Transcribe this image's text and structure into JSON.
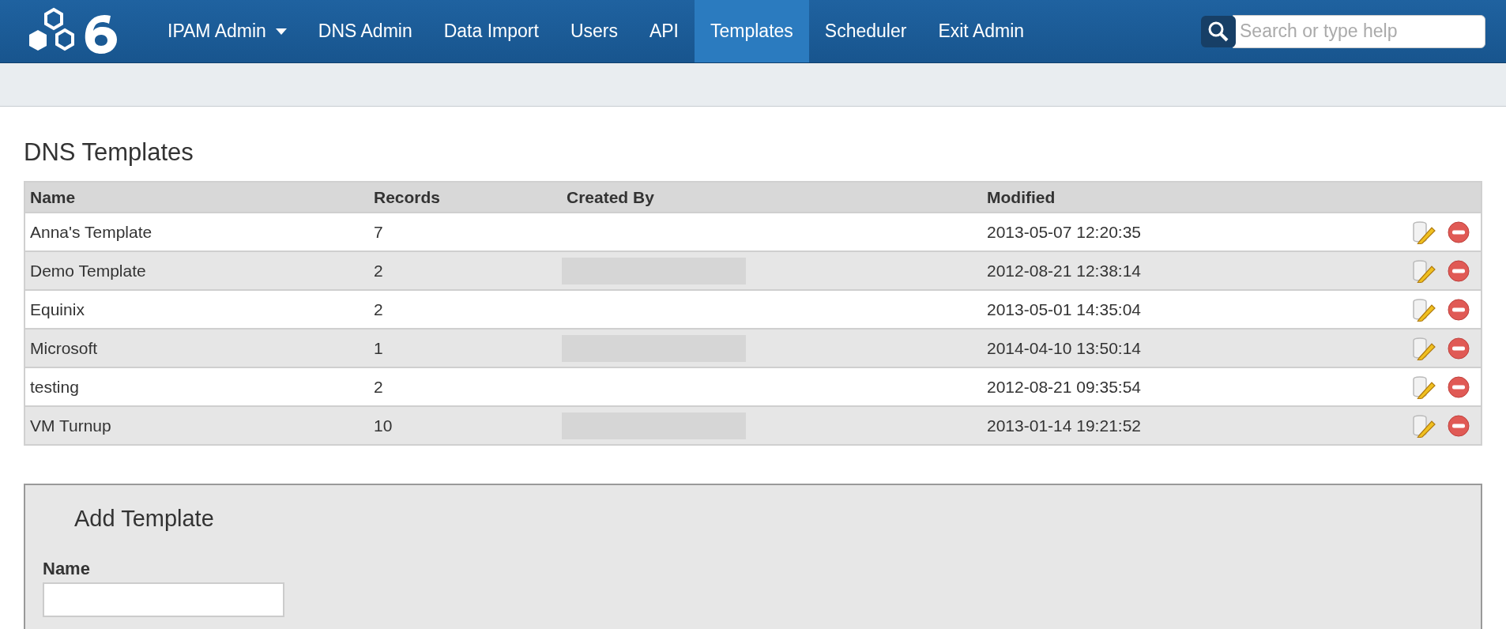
{
  "navbar": {
    "items": [
      {
        "label": "IPAM Admin",
        "selected": false,
        "dropdown": true
      },
      {
        "label": "DNS Admin",
        "selected": false,
        "dropdown": false
      },
      {
        "label": "Data Import",
        "selected": false,
        "dropdown": false
      },
      {
        "label": "Users",
        "selected": false,
        "dropdown": false
      },
      {
        "label": "API",
        "selected": false,
        "dropdown": false
      },
      {
        "label": "Templates",
        "selected": true,
        "dropdown": false
      },
      {
        "label": "Scheduler",
        "selected": false,
        "dropdown": false
      },
      {
        "label": "Exit Admin",
        "selected": false,
        "dropdown": false
      }
    ],
    "search": {
      "placeholder": "Search or type help"
    }
  },
  "page_title": "DNS Templates",
  "table": {
    "columns": [
      "Name",
      "Records",
      "Created By",
      "Modified"
    ],
    "rows": [
      {
        "name": "Anna's Template",
        "records": "7",
        "created_by_redacted": false,
        "modified": "2013-05-07 12:20:35"
      },
      {
        "name": "Demo Template",
        "records": "2",
        "created_by_redacted": true,
        "modified": "2012-08-21 12:38:14"
      },
      {
        "name": "Equinix",
        "records": "2",
        "created_by_redacted": false,
        "modified": "2013-05-01 14:35:04"
      },
      {
        "name": "Microsoft",
        "records": "1",
        "created_by_redacted": true,
        "modified": "2014-04-10 13:50:14"
      },
      {
        "name": "testing",
        "records": "2",
        "created_by_redacted": false,
        "modified": "2012-08-21 09:35:54"
      },
      {
        "name": "VM Turnup",
        "records": "10",
        "created_by_redacted": true,
        "modified": "2013-01-14 19:21:52"
      }
    ]
  },
  "add_template": {
    "title": "Add Template",
    "name_label": "Name"
  }
}
